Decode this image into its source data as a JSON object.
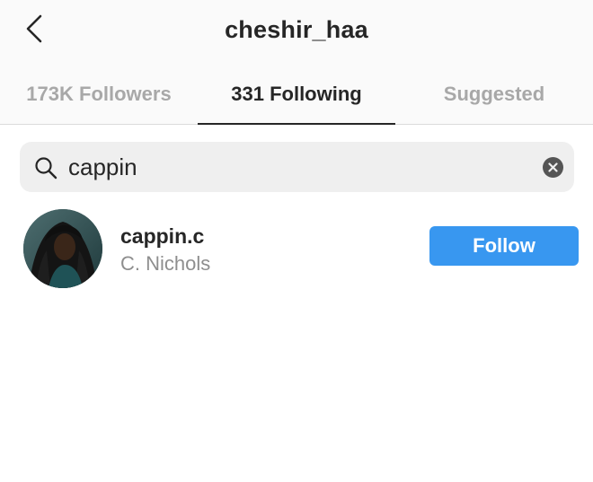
{
  "header": {
    "title": "cheshir_haa",
    "back_icon": "chevron-left-icon"
  },
  "tabs": [
    {
      "label": "173K Followers",
      "active": false
    },
    {
      "label": "331 Following",
      "active": true
    },
    {
      "label": "Suggested",
      "active": false
    }
  ],
  "search": {
    "value": "cappin",
    "placeholder": "Search",
    "icon": "search-icon",
    "clear_icon": "clear-icon"
  },
  "results": [
    {
      "username": "cappin.c",
      "full_name": "C. Nichols",
      "button_label": "Follow"
    }
  ],
  "colors": {
    "accent": "#3897f0",
    "text_primary": "#262626",
    "text_secondary": "#8e8e8e",
    "header_background": "#fafafa",
    "search_background": "#efefef"
  }
}
